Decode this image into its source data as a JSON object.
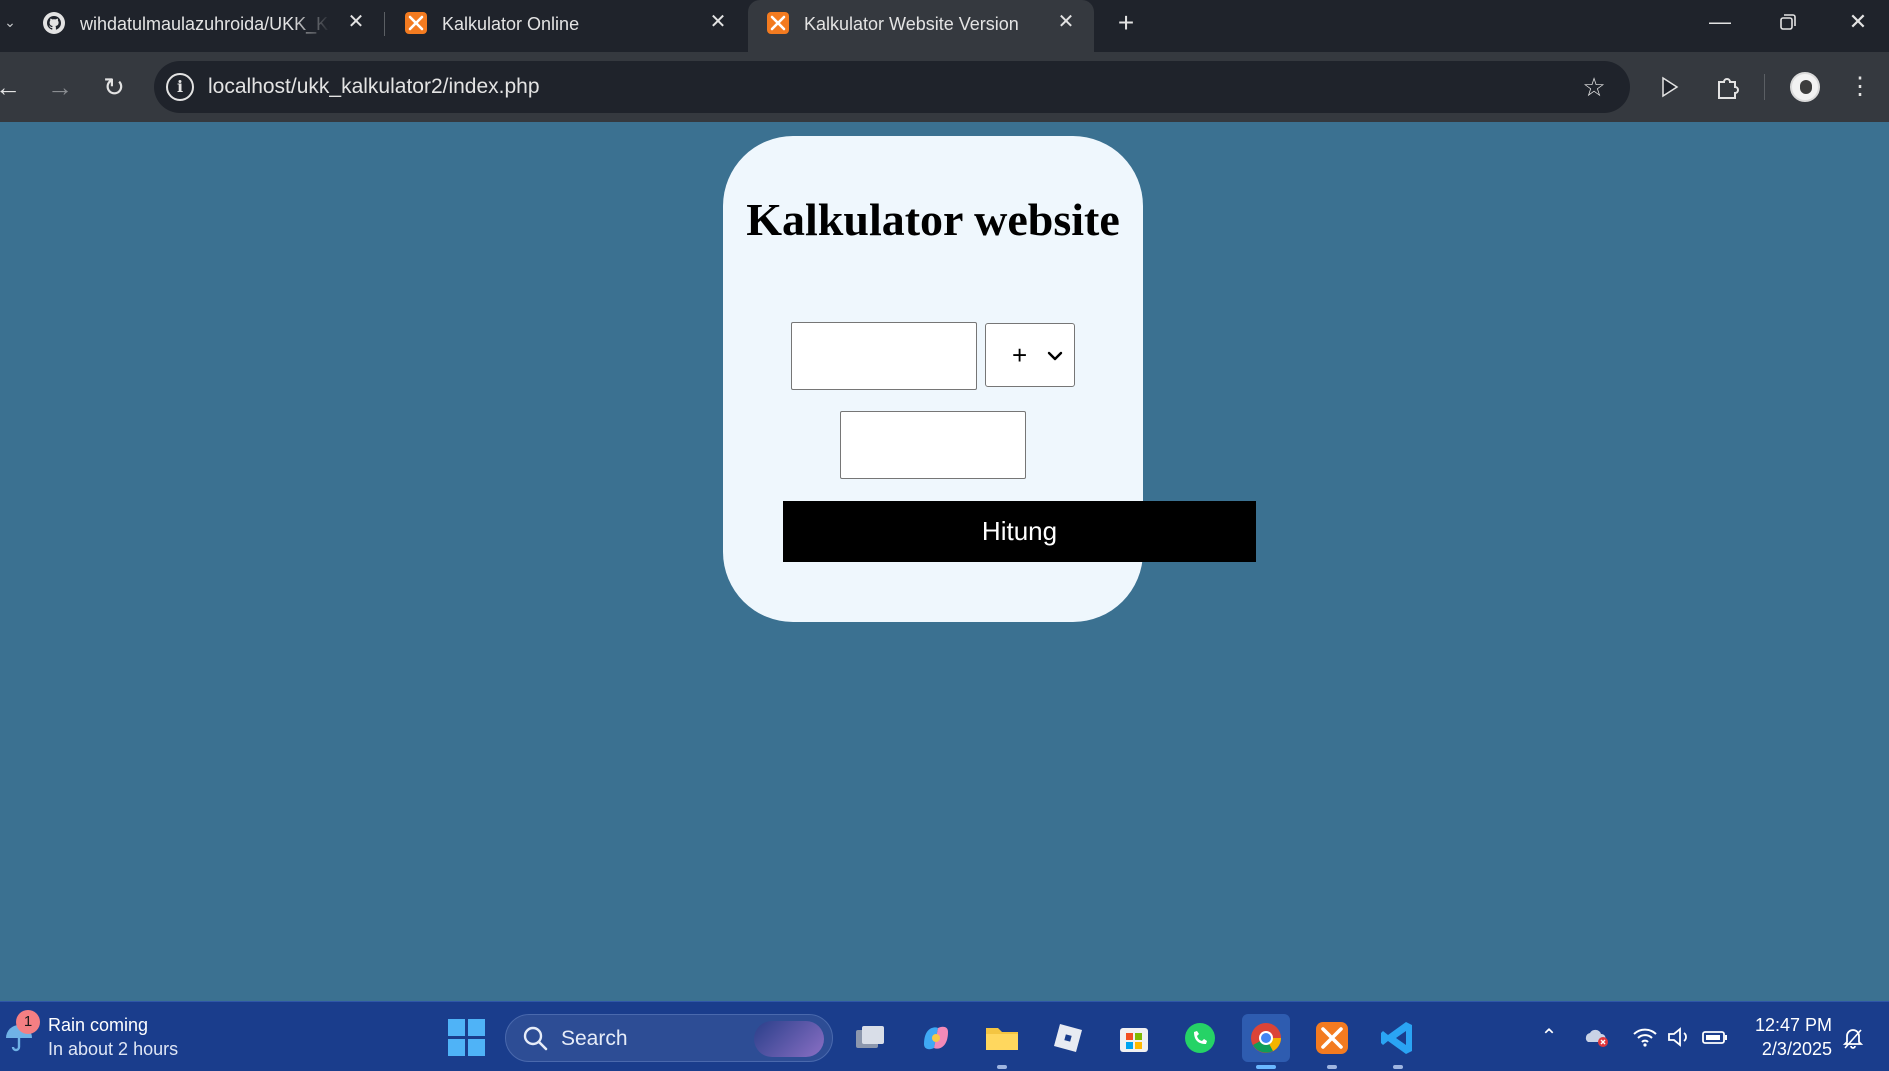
{
  "browser": {
    "tabs": [
      {
        "title": "wihdatulmaulazuhroida/UKK_Kalkulator",
        "favicon": "github-icon",
        "active": false
      },
      {
        "title": "Kalkulator Online",
        "favicon": "xampp-icon",
        "active": false
      },
      {
        "title": "Kalkulator Website Version",
        "favicon": "xampp-icon",
        "active": true
      }
    ],
    "url": "localhost/ukk_kalkulator2/index.php"
  },
  "page": {
    "title": "Kalkulator website",
    "first_number": "",
    "operator": "+",
    "second_number": "",
    "submit_label": "Hitung",
    "background_color": "#3b7191",
    "card_color": "#eff7fd"
  },
  "taskbar": {
    "weather": {
      "badge": "1",
      "title": "Rain coming",
      "subtitle": "In about 2 hours"
    },
    "search_label": "Search",
    "clock": {
      "time": "12:47 PM",
      "date": "2/3/2025"
    }
  }
}
